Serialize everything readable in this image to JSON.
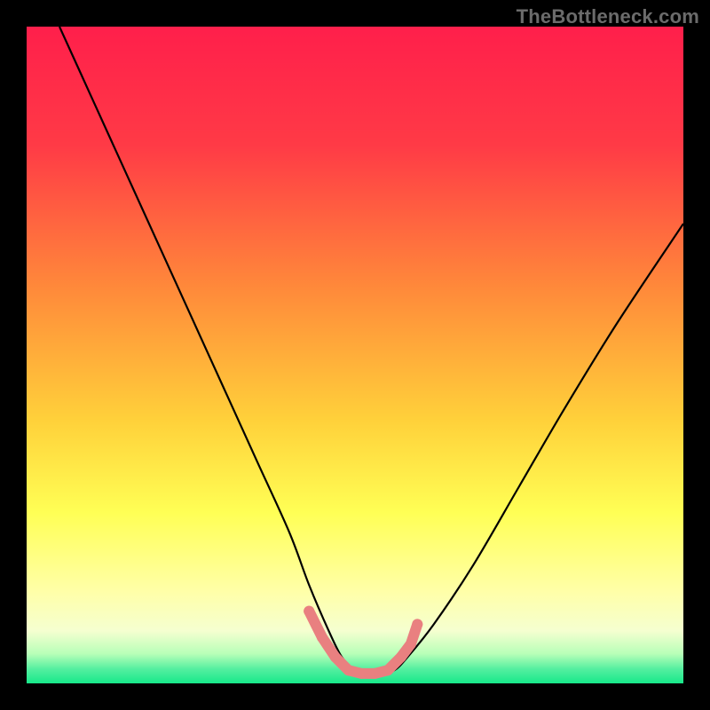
{
  "watermark": "TheBottleneck.com",
  "chart_data": {
    "type": "line",
    "title": "",
    "xlabel": "",
    "ylabel": "",
    "xlim": [
      0,
      100
    ],
    "ylim": [
      0,
      100
    ],
    "grid": false,
    "legend": false,
    "gradient_stops": [
      {
        "offset": 0.0,
        "color": "#ff1f4b"
      },
      {
        "offset": 0.18,
        "color": "#ff3a46"
      },
      {
        "offset": 0.4,
        "color": "#ff8a3a"
      },
      {
        "offset": 0.6,
        "color": "#ffd13a"
      },
      {
        "offset": 0.74,
        "color": "#ffff55"
      },
      {
        "offset": 0.86,
        "color": "#ffffa8"
      },
      {
        "offset": 0.92,
        "color": "#f5ffd0"
      },
      {
        "offset": 0.955,
        "color": "#b8ffb8"
      },
      {
        "offset": 0.978,
        "color": "#55efa0"
      },
      {
        "offset": 1.0,
        "color": "#17e88a"
      }
    ],
    "series": [
      {
        "name": "bottleneck-curve",
        "color": "#000000",
        "width": 2.2,
        "x": [
          5,
          10,
          15,
          20,
          25,
          30,
          35,
          40,
          43,
          46,
          48,
          50,
          52,
          54,
          56,
          58,
          62,
          68,
          75,
          82,
          90,
          100
        ],
        "y": [
          100,
          89,
          78,
          67,
          56,
          45,
          34,
          23,
          15,
          8,
          4,
          2,
          1.5,
          1.5,
          2,
          4,
          9,
          18,
          30,
          42,
          55,
          70
        ]
      },
      {
        "name": "highlight-dots",
        "color": "#e98080",
        "type": "scatter",
        "radius": 6,
        "x": [
          43,
          45,
          47,
          49,
          51,
          53,
          55,
          57,
          58.5,
          59.5
        ],
        "y": [
          11,
          7,
          4,
          2,
          1.5,
          1.5,
          2,
          4,
          6,
          9
        ]
      }
    ]
  }
}
